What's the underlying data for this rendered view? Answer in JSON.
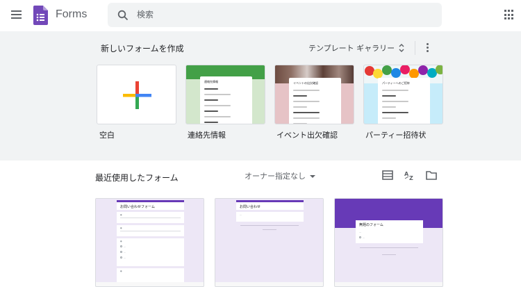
{
  "header": {
    "app_title": "Forms",
    "search_placeholder": "検索"
  },
  "gallery": {
    "title": "新しいフォームを作成",
    "toggle_label": "テンプレート ギャラリー",
    "templates": [
      {
        "label": "空白"
      },
      {
        "label": "連絡先情報",
        "preview_title": "連絡先情報"
      },
      {
        "label": "イベント出欠確認",
        "preview_title": "イベントの出欠確認"
      },
      {
        "label": "パーティー招待状",
        "preview_title": "パーティーへのご招待"
      }
    ]
  },
  "recent": {
    "title": "最近使用したフォーム",
    "owner_filter": "オーナー指定なし",
    "forms": [
      {
        "thumb_title": "お問い合わせフォーム"
      },
      {
        "thumb_title": "お問い合わせ"
      },
      {
        "thumb_title": "無題のフォーム"
      }
    ]
  },
  "colors": {
    "forms_purple": "#673ab7",
    "gallery_bg": "#f1f3f4",
    "contact_green": "#43a047",
    "event_pink": "#e6c3c6",
    "party_blue": "#c6ecfa"
  },
  "icons": [
    "menu-icon",
    "forms-logo-icon",
    "search-icon",
    "apps-icon",
    "unfold-more-icon",
    "more-vert-icon",
    "list-view-icon",
    "sort-az-icon",
    "folder-icon"
  ]
}
